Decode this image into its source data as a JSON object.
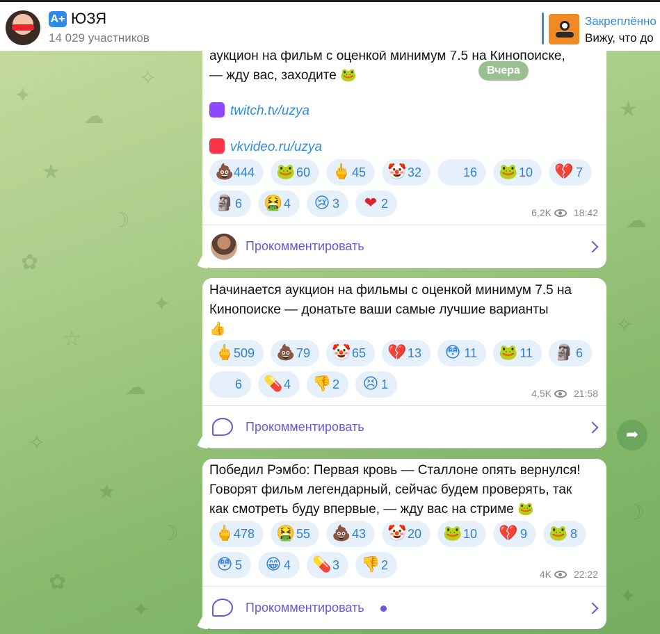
{
  "header": {
    "badge_label": "A+",
    "title": "ЮЗЯ",
    "subscribers": "14 029 участников",
    "pinned_title": "Закреплённо",
    "pinned_text": "Вижу, что до"
  },
  "date_pill": "Вчера",
  "posts": [
    {
      "lines": [
        "аукцион на фильм с оценкой минимум 7.5 на Кинопоиске,",
        "— жду вас, заходите 🐸"
      ],
      "links": [
        {
          "icon": "twitch-icon",
          "color": "#9146ff",
          "text": "twitch.tv/uzya"
        },
        {
          "icon": "vkvideo-icon",
          "color": "#ff3347",
          "text": "vkvideo.ru/uzya"
        }
      ],
      "reactions_row1": [
        {
          "emoji": "💩",
          "count": "444"
        },
        {
          "emoji": "🐸",
          "count": "60"
        },
        {
          "emoji": "🖕",
          "count": "45"
        },
        {
          "emoji": "🤡",
          "count": "32"
        },
        {
          "emoji": "",
          "count": "16"
        },
        {
          "emoji": "🐸",
          "count": "10"
        },
        {
          "emoji": "💔",
          "count": "7"
        }
      ],
      "reactions_row2": [
        {
          "emoji": "🗿",
          "count": "6"
        },
        {
          "emoji": "🤮",
          "count": "4"
        },
        {
          "emoji": "😢",
          "count": "3"
        },
        {
          "emoji": "❤",
          "count": "2"
        }
      ],
      "views": "6,2K",
      "time": "18:42",
      "comment_label": "Прокомментировать"
    },
    {
      "lines": [
        "Начинается аукцион на фильмы с оценкой минимум 7.5 на",
        "Кинопоиске — донатьте ваши самые лучшие варианты",
        "👍"
      ],
      "reactions_row1": [
        {
          "emoji": "🖕",
          "count": "509"
        },
        {
          "emoji": "💩",
          "count": "79"
        },
        {
          "emoji": "🤡",
          "count": "65"
        },
        {
          "emoji": "💔",
          "count": "13"
        },
        {
          "emoji": "😳",
          "count": "11"
        },
        {
          "emoji": "🐸",
          "count": "11"
        },
        {
          "emoji": "🗿",
          "count": "6"
        }
      ],
      "reactions_row2": [
        {
          "emoji": "",
          "count": "6"
        },
        {
          "emoji": "💊",
          "count": "4"
        },
        {
          "emoji": "👎",
          "count": "2"
        },
        {
          "emoji": "😣",
          "count": "1"
        }
      ],
      "views": "4,5K",
      "time": "21:58",
      "comment_label": "Прокомментировать"
    },
    {
      "lines": [
        "Победил Рэмбо: Первая кровь — Сталлоне опять вернулся!",
        "Говорят фильм легендарный, сейчас будем проверять, так",
        "как смотреть буду впервые, — жду вас на стриме 🐸"
      ],
      "reactions_row1": [
        {
          "emoji": "🖕",
          "count": "478"
        },
        {
          "emoji": "🤮",
          "count": "55"
        },
        {
          "emoji": "💩",
          "count": "43"
        },
        {
          "emoji": "🤡",
          "count": "20"
        },
        {
          "emoji": "🐸",
          "count": "10"
        },
        {
          "emoji": "💔",
          "count": "9"
        },
        {
          "emoji": "🐸",
          "count": "8"
        }
      ],
      "reactions_row2": [
        {
          "emoji": "😳",
          "count": "5"
        },
        {
          "emoji": "😁",
          "count": "4"
        },
        {
          "emoji": "💊",
          "count": "3"
        },
        {
          "emoji": "👎",
          "count": "2"
        }
      ],
      "views": "4K",
      "time": "22:22",
      "comment_label": "Прокомментировать"
    }
  ],
  "share_icon": "➦"
}
